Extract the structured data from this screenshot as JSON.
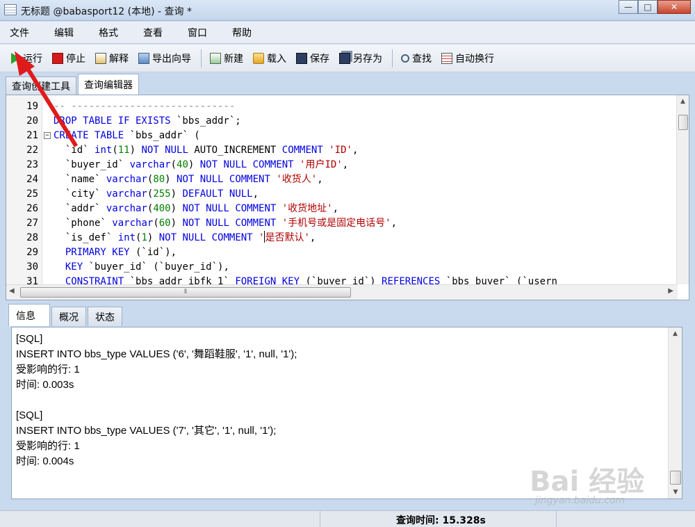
{
  "window": {
    "title": "无标题 @babasport12 (本地) - 查询 *",
    "minimize": "—",
    "maximize": "□",
    "close": "✕"
  },
  "menu": [
    "文件",
    "编辑",
    "格式",
    "查看",
    "窗口",
    "帮助"
  ],
  "toolbar": {
    "run": "运行",
    "stop": "停止",
    "explain": "解释",
    "export_wizard": "导出向导",
    "new": "新建",
    "load": "载入",
    "save": "保存",
    "save_as": "另存为",
    "find": "查找",
    "word_wrap": "自动换行"
  },
  "upper_tabs": [
    "查询创建工具",
    "查询编辑器"
  ],
  "editor": {
    "lines": [
      {
        "n": "19",
        "parts": [
          {
            "t": "-- ----------------------------",
            "c": "cm"
          }
        ]
      },
      {
        "n": "20",
        "parts": [
          {
            "t": "DROP TABLE IF EXISTS",
            "c": "kw"
          },
          {
            "t": " `bbs_addr`;",
            "c": ""
          }
        ]
      },
      {
        "n": "21",
        "fold": "−",
        "parts": [
          {
            "t": "CREATE TABLE",
            "c": "kw"
          },
          {
            "t": " `bbs_addr` (",
            "c": ""
          }
        ]
      },
      {
        "n": "22",
        "parts": [
          {
            "t": "  `id` ",
            "c": ""
          },
          {
            "t": "int",
            "c": "ty"
          },
          {
            "t": "(",
            "c": ""
          },
          {
            "t": "11",
            "c": "num"
          },
          {
            "t": ") ",
            "c": ""
          },
          {
            "t": "NOT NULL",
            "c": "kw"
          },
          {
            "t": " AUTO_INCREMENT ",
            "c": ""
          },
          {
            "t": "COMMENT",
            "c": "kw"
          },
          {
            "t": " 'ID'",
            "c": "str"
          },
          {
            "t": ",",
            "c": ""
          }
        ]
      },
      {
        "n": "23",
        "parts": [
          {
            "t": "  `buyer_id` ",
            "c": ""
          },
          {
            "t": "varchar",
            "c": "ty"
          },
          {
            "t": "(",
            "c": ""
          },
          {
            "t": "40",
            "c": "num"
          },
          {
            "t": ") ",
            "c": ""
          },
          {
            "t": "NOT NULL COMMENT",
            "c": "kw"
          },
          {
            "t": " '用户ID'",
            "c": "str"
          },
          {
            "t": ",",
            "c": ""
          }
        ]
      },
      {
        "n": "24",
        "parts": [
          {
            "t": "  `name` ",
            "c": ""
          },
          {
            "t": "varchar",
            "c": "ty"
          },
          {
            "t": "(",
            "c": ""
          },
          {
            "t": "80",
            "c": "num"
          },
          {
            "t": ") ",
            "c": ""
          },
          {
            "t": "NOT NULL COMMENT",
            "c": "kw"
          },
          {
            "t": " '收货人'",
            "c": "str"
          },
          {
            "t": ",",
            "c": ""
          }
        ]
      },
      {
        "n": "25",
        "parts": [
          {
            "t": "  `city` ",
            "c": ""
          },
          {
            "t": "varchar",
            "c": "ty"
          },
          {
            "t": "(",
            "c": ""
          },
          {
            "t": "255",
            "c": "num"
          },
          {
            "t": ") ",
            "c": ""
          },
          {
            "t": "DEFAULT NULL",
            "c": "kw"
          },
          {
            "t": ",",
            "c": ""
          }
        ]
      },
      {
        "n": "26",
        "parts": [
          {
            "t": "  `addr` ",
            "c": ""
          },
          {
            "t": "varchar",
            "c": "ty"
          },
          {
            "t": "(",
            "c": ""
          },
          {
            "t": "400",
            "c": "num"
          },
          {
            "t": ") ",
            "c": ""
          },
          {
            "t": "NOT NULL COMMENT",
            "c": "kw"
          },
          {
            "t": " '收货地址'",
            "c": "str"
          },
          {
            "t": ",",
            "c": ""
          }
        ]
      },
      {
        "n": "27",
        "parts": [
          {
            "t": "  `phone` ",
            "c": ""
          },
          {
            "t": "varchar",
            "c": "ty"
          },
          {
            "t": "(",
            "c": ""
          },
          {
            "t": "60",
            "c": "num"
          },
          {
            "t": ") ",
            "c": ""
          },
          {
            "t": "NOT NULL COMMENT",
            "c": "kw"
          },
          {
            "t": " '手机号或是固定电话号'",
            "c": "str"
          },
          {
            "t": ",",
            "c": ""
          }
        ]
      },
      {
        "n": "28",
        "parts": [
          {
            "t": "  `is_def` ",
            "c": ""
          },
          {
            "t": "int",
            "c": "ty"
          },
          {
            "t": "(",
            "c": ""
          },
          {
            "t": "1",
            "c": "num"
          },
          {
            "t": ") ",
            "c": ""
          },
          {
            "t": "NOT NULL COMMENT",
            "c": "kw"
          },
          {
            "t": " '",
            "c": "str"
          },
          {
            "t": "|",
            "c": "caret"
          },
          {
            "t": "是否默认'",
            "c": "str"
          },
          {
            "t": ",",
            "c": ""
          }
        ]
      },
      {
        "n": "29",
        "parts": [
          {
            "t": "  PRIMARY KEY",
            "c": "kw"
          },
          {
            "t": " (`id`),",
            "c": ""
          }
        ]
      },
      {
        "n": "30",
        "parts": [
          {
            "t": "  KEY",
            "c": "kw"
          },
          {
            "t": " `buyer_id` (`buyer_id`),",
            "c": ""
          }
        ]
      },
      {
        "n": "31",
        "parts": [
          {
            "t": "  CONSTRAINT",
            "c": "kw"
          },
          {
            "t": " `bbs_addr_ibfk_1` ",
            "c": ""
          },
          {
            "t": "FOREIGN KEY",
            "c": "kw"
          },
          {
            "t": " (`buyer_id`) ",
            "c": ""
          },
          {
            "t": "REFERENCES",
            "c": "kw"
          },
          {
            "t": " `bbs_buyer` (`usern",
            "c": ""
          }
        ]
      }
    ]
  },
  "lower_tabs": [
    "信息",
    "概况",
    "状态"
  ],
  "output": {
    "lines": [
      "[SQL]",
      "INSERT INTO bbs_type VALUES ('6', '舞蹈鞋服', '1', null, '1');",
      "受影响的行: 1",
      "时间: 0.003s",
      "",
      "[SQL]",
      "INSERT INTO bbs_type VALUES ('7', '其它', '1', null, '1');",
      "受影响的行: 1",
      "时间: 0.004s"
    ]
  },
  "status": {
    "query_time": "查询时间: 15.328s"
  },
  "watermark": {
    "text": "Bai 经验",
    "url": "jingyan.baidu.com"
  },
  "colors": {
    "keyword": "#0000e0",
    "number": "#008000",
    "string": "#b00000",
    "annotation_arrow": "#e01b1b"
  }
}
